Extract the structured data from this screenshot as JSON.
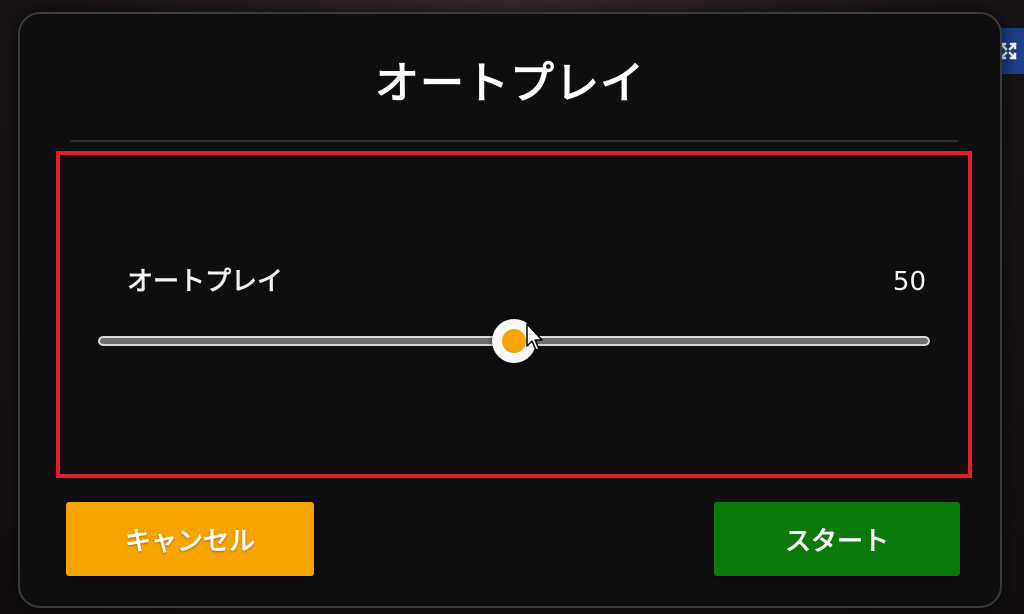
{
  "dialog": {
    "title": "オートプレイ"
  },
  "slider": {
    "label": "オートプレイ",
    "value": "50",
    "min": 0,
    "max": 100,
    "fraction": 0.5,
    "thumb_color": "#f7a400"
  },
  "buttons": {
    "cancel_label": "キャンセル",
    "start_label": "スタート",
    "cancel_color": "#f7a400",
    "start_color": "#0b7a0b"
  },
  "highlight": {
    "color": "#e2202a"
  },
  "icons": {
    "expand": "expand-icon",
    "cursor": "mouse-pointer-icon"
  }
}
